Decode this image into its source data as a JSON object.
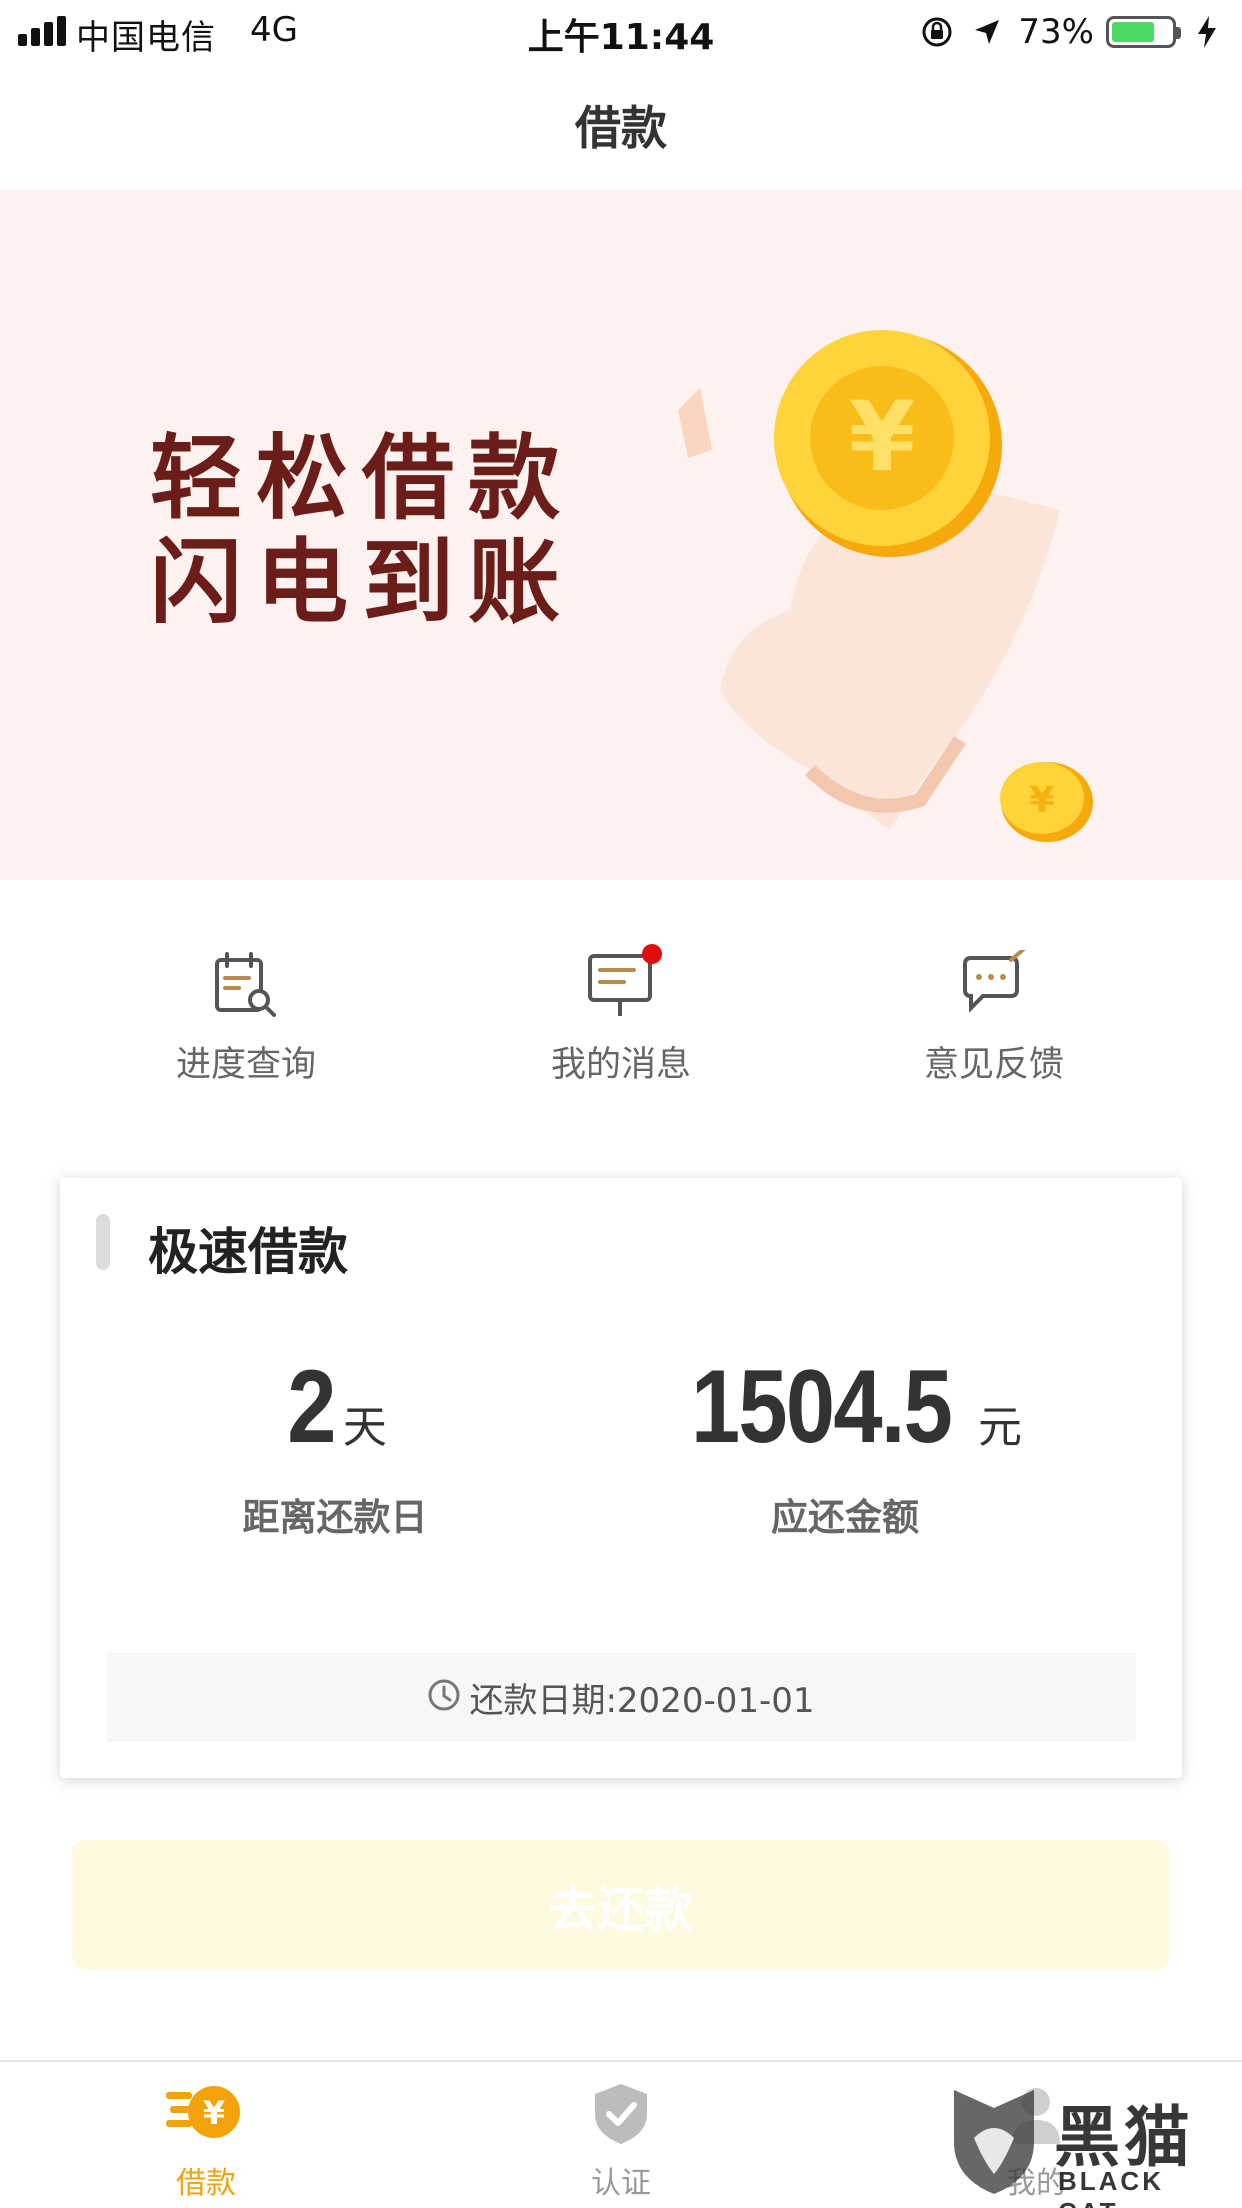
{
  "status_bar": {
    "carrier": "中国电信",
    "network": "4G",
    "time": "上午11:44",
    "battery_percent": "73%",
    "battery_level": 0.73
  },
  "nav": {
    "title": "借款"
  },
  "banner": {
    "line1": "轻松借款",
    "line2": "闪电到账"
  },
  "quick_actions": [
    {
      "label": "进度查询",
      "icon": "clipboard-search-icon"
    },
    {
      "label": "我的消息",
      "icon": "message-board-icon",
      "has_badge": true
    },
    {
      "label": "意见反馈",
      "icon": "feedback-chat-icon"
    }
  ],
  "loan_card": {
    "title": "极速借款",
    "days_value": "2",
    "days_unit": "天",
    "days_label": "距离还款日",
    "amount_value": "1504.5",
    "amount_unit": "元",
    "amount_label": "应还金额",
    "due_date_text": "还款日期:2020-01-01"
  },
  "repay_button": {
    "label": "去还款"
  },
  "tab_bar": [
    {
      "label": "借款",
      "icon": "yuan-coins-icon",
      "active": true
    },
    {
      "label": "认证",
      "icon": "shield-check-icon",
      "active": false
    },
    {
      "label": "我的",
      "icon": "person-icon",
      "active": false
    }
  ],
  "watermark": {
    "cn": "黑猫",
    "en": "BLACK CAT"
  },
  "colors": {
    "accent": "#f4a20a",
    "banner_bg": "#fdf2ef",
    "banner_text": "#6b1d1a",
    "badge_red": "#e10d0d",
    "button_bg": "#fdfadf"
  }
}
